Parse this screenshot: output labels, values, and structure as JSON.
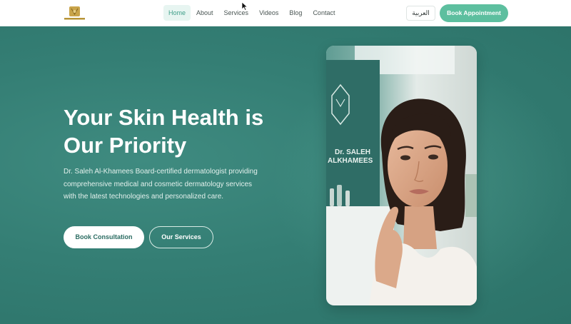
{
  "header": {
    "logo_icon": "gold-crest-logo-icon",
    "nav": [
      {
        "label": "Home",
        "active": true
      },
      {
        "label": "About",
        "active": false
      },
      {
        "label": "Services",
        "active": false
      },
      {
        "label": "Videos",
        "active": false
      },
      {
        "label": "Blog",
        "active": false
      },
      {
        "label": "Contact",
        "active": false
      }
    ],
    "language_button": "العربية",
    "book_button": "Book Appointment"
  },
  "hero": {
    "title": "Your Skin Health is Our Priority",
    "description": "Dr. Saleh Al-Khamees Board-certified dermatologist providing comprehensive medical and cosmetic dermatology services with the latest technologies and personalized care.",
    "primary_button": "Book Consultation",
    "secondary_button": "Our Services",
    "photo": {
      "clinic_sign_line1": "Dr. SALEH",
      "clinic_sign_line2": "ALKHAMEES"
    }
  },
  "colors": {
    "accent": "#5dbf9f",
    "hero_bg": "#347e74",
    "nav_active_bg": "#e7f5f1",
    "nav_active_text": "#3e9e88"
  }
}
